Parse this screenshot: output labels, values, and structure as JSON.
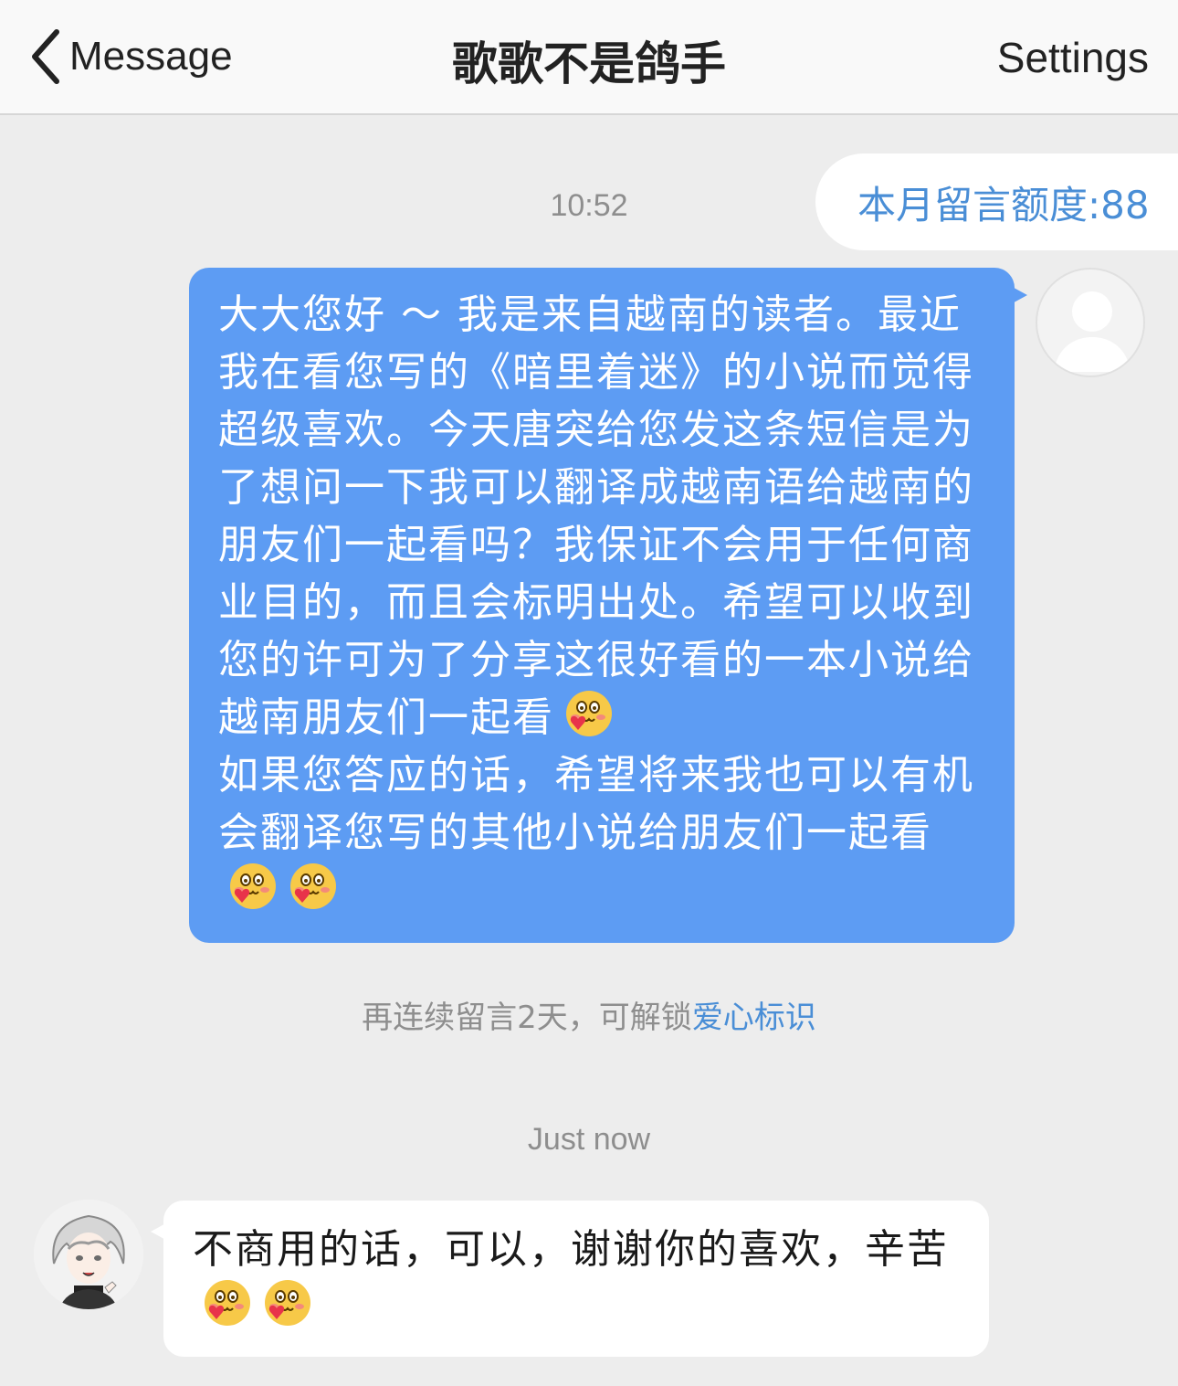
{
  "navbar": {
    "back_label": "Message",
    "title": "歌歌不是鸽手",
    "settings_label": "Settings"
  },
  "quota": {
    "text": "本月留言额度:88"
  },
  "messages": [
    {
      "direction": "outgoing",
      "time": "10:52",
      "text": "大大您好 ～ 我是来自越南的读者。最近我在看您写的《暗里着迷》的小说而觉得超级喜欢。今天唐突给您发这条短信是为了想问一下我可以翻译成越南语给越南的朋友们一起看吗？我保证不会用于任何商业目的，而且会标明出处。希望可以收到您的许可为了分享这很好看的一本小说给越南朋友们一起看",
      "text_2": "如果您答应的话，希望将来我也可以有机会翻译您写的其他小说给朋友们一起看",
      "avatar_icon": "default-person-icon"
    },
    {
      "direction": "incoming",
      "time": "Just now",
      "text": "不商用的话，可以，谢谢你的喜欢，辛苦",
      "avatar_icon": "anime-character-avatar"
    }
  ],
  "unlock_hint": {
    "prefix": "再连续留言2天，可解锁",
    "link": "爱心标识"
  },
  "emoji_name": "blush-heart-emoji",
  "colors": {
    "nav_bg": "#f9f9f9",
    "page_bg": "#ededed",
    "outgoing_bubble": "#5d9cf3",
    "incoming_bubble": "#ffffff",
    "accent": "#4a8ed6"
  }
}
